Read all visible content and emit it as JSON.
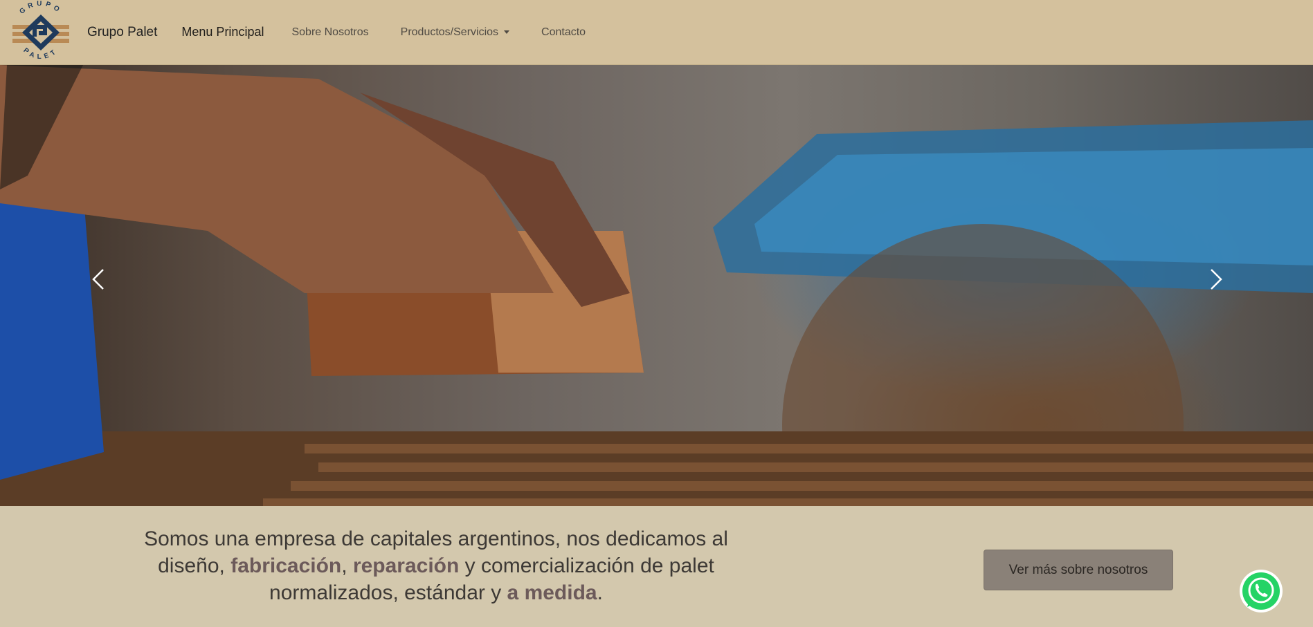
{
  "navbar": {
    "logo_text_top": "GRUPO",
    "logo_text_bottom": "PALET",
    "brand": "Grupo Palet",
    "links": [
      {
        "label": "Menu Principal",
        "active": true
      },
      {
        "label": "Sobre Nosotros",
        "active": false
      },
      {
        "label": "Productos/Servicios",
        "active": false,
        "dropdown": true
      },
      {
        "label": "Contacto",
        "active": false
      }
    ]
  },
  "hero": {
    "prev_icon": "chevron-left-icon",
    "next_icon": "chevron-right-icon"
  },
  "intro": {
    "part1": "Somos una empresa de capitales argentinos, nos dedicamos al diseño, ",
    "hl1": "fabricación",
    "sep1": ", ",
    "hl2": "reparación",
    "part2": " y comercialización de palet normalizados, estándar y ",
    "hl3": "a medida",
    "part3": "."
  },
  "cta": {
    "label": "Ver más sobre nosotros"
  },
  "whatsapp": {
    "icon": "whatsapp-icon"
  },
  "colors": {
    "navbar_bg": "#d4c19d",
    "page_bg": "#d3c8ad",
    "highlight": "#6c5a5a",
    "cta_bg": "#8a8178",
    "logo_blue": "#1e3a5c",
    "logo_wood": "#b98a55",
    "whatsapp_green": "#25d366"
  }
}
